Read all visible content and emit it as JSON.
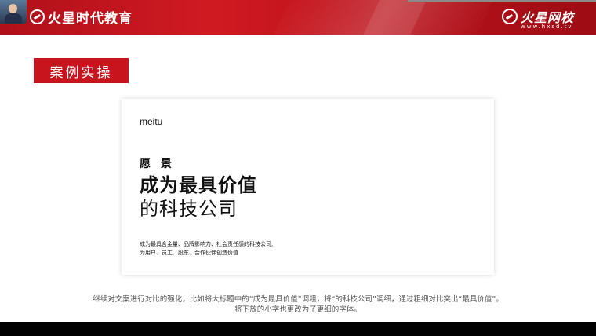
{
  "header": {
    "org_name": "火星时代教育",
    "right_logo_name": "火星网校",
    "right_logo_url": "www.hxsd.tv",
    "background_color": "#c8141c",
    "logo_icon": "hxsd-logo-icon"
  },
  "section_tag": {
    "label": "案例实操",
    "color": "#c8141c"
  },
  "card": {
    "brand": "meitu",
    "vision_label": "愿 景",
    "headline_bold": "成为最具价值",
    "headline_thin": "的科技公司",
    "description_line1": "成为最具含金量、品牌影响力、社会责任感的科技公司,",
    "description_line2": "为用户、员工、股东、合作伙伴创造价值"
  },
  "caption": {
    "line1": "继续对文案进行对比的强化，比如将大标题中的“成为最具价值”调粗，将“的科技公司”调细，通过粗细对比突出“最具价值”。",
    "line2": "将下放的小字也更改为了更细的字体。"
  }
}
